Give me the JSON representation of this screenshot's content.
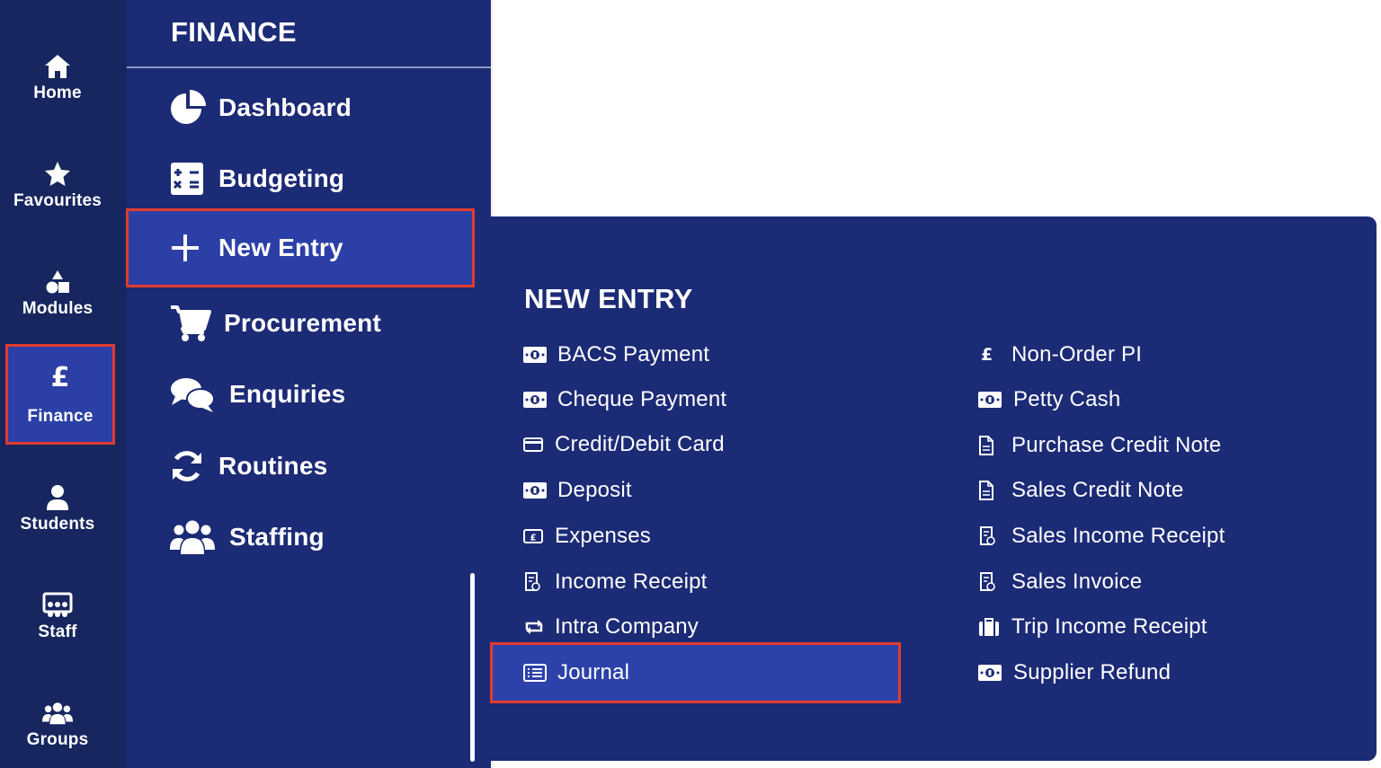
{
  "rail": {
    "items": [
      {
        "label": "Home",
        "icon": "home-icon"
      },
      {
        "label": "Favourites",
        "icon": "star-icon"
      },
      {
        "label": "Modules",
        "icon": "shapes-icon"
      },
      {
        "label": "Finance",
        "icon": "pound-icon",
        "active": true
      },
      {
        "label": "Students",
        "icon": "user-icon"
      },
      {
        "label": "Staff",
        "icon": "chalkboard-teacher-icon"
      },
      {
        "label": "Groups",
        "icon": "users-icon"
      }
    ]
  },
  "finance": {
    "title": "FINANCE",
    "items": [
      {
        "label": "Dashboard",
        "icon": "pie-chart-icon"
      },
      {
        "label": "Budgeting",
        "icon": "calculator-icon"
      },
      {
        "label": "New Entry",
        "icon": "plus-icon",
        "active": true
      },
      {
        "label": "Procurement",
        "icon": "cart-icon"
      },
      {
        "label": "Enquiries",
        "icon": "comments-icon"
      },
      {
        "label": "Routines",
        "icon": "sync-icon"
      },
      {
        "label": "Staffing",
        "icon": "users-icon"
      }
    ]
  },
  "new_entry": {
    "title": "NEW ENTRY",
    "left": [
      {
        "label": "BACS Payment",
        "icon": "money-bill-icon"
      },
      {
        "label": "Cheque Payment",
        "icon": "money-bill-icon"
      },
      {
        "label": "Credit/Debit Card",
        "icon": "credit-card-icon"
      },
      {
        "label": "Deposit",
        "icon": "money-bill-icon"
      },
      {
        "label": "Expenses",
        "icon": "pound-box-icon"
      },
      {
        "label": "Income Receipt",
        "icon": "receipt-icon"
      },
      {
        "label": "Intra Company",
        "icon": "exchange-icon"
      },
      {
        "label": "Journal",
        "icon": "list-icon",
        "active": true
      }
    ],
    "right": [
      {
        "label": "Non-Order PI",
        "icon": "pound-icon"
      },
      {
        "label": "Petty Cash",
        "icon": "money-bill-icon"
      },
      {
        "label": "Purchase Credit Note",
        "icon": "document-icon"
      },
      {
        "label": "Sales Credit Note",
        "icon": "document-icon"
      },
      {
        "label": "Sales Income Receipt",
        "icon": "receipt-icon"
      },
      {
        "label": "Sales Invoice",
        "icon": "receipt-icon"
      },
      {
        "label": "Trip Income Receipt",
        "icon": "suitcase-icon"
      },
      {
        "label": "Supplier Refund",
        "icon": "money-bill-icon"
      }
    ]
  },
  "colors": {
    "rail_bg": "#17265f",
    "panel_bg": "#1c2b76",
    "active_bg": "#2b3fa6",
    "highlight_border": "#e23b2e"
  }
}
